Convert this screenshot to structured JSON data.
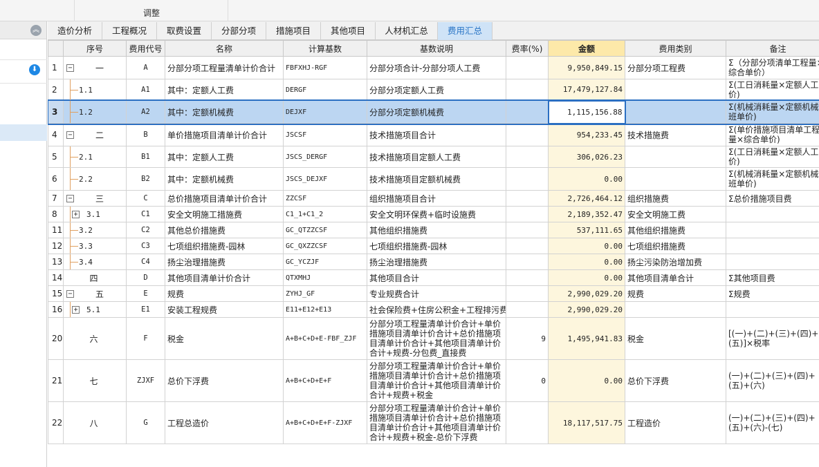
{
  "toolbar": {
    "adjust_label": "调整"
  },
  "tabs": [
    {
      "label": "造价分析",
      "w": 79
    },
    {
      "label": "工程概况",
      "w": 79
    },
    {
      "label": "取费设置",
      "w": 79
    },
    {
      "label": "分部分项",
      "w": 79
    },
    {
      "label": "措施项目",
      "w": 79
    },
    {
      "label": "其他项目",
      "w": 79
    },
    {
      "label": "人材机汇总",
      "w": 90
    },
    {
      "label": "费用汇总",
      "w": 79,
      "active": true
    }
  ],
  "table": {
    "headers": [
      "",
      "序号",
      "费用代号",
      "名称",
      "计算基数",
      "基数说明",
      "费率(%)",
      "金额",
      "费用类别",
      "备注"
    ],
    "rows": [
      {
        "rn": "1",
        "seq": "一",
        "lvl": 0,
        "tog": "−",
        "code": "A",
        "name": "分部分项工程量清单计价合计",
        "base": "FBFXHJ-RGF",
        "desc": "分部分项合计-分部分项人工费",
        "rate": "",
        "amt": "9,950,849.15",
        "cat": "分部分项工程费",
        "note": "Σ（分部分项清单工程量×综合单价）",
        "h": 33
      },
      {
        "rn": "2",
        "seq": "1.1",
        "lvl": 1,
        "code": "A1",
        "name": "其中：定额人工费",
        "base": "DERGF",
        "desc": "分部分项定额人工费",
        "rate": "",
        "amt": "17,479,127.84",
        "cat": "",
        "note": "Σ(工日消耗量×定额人工单价)",
        "h": 23
      },
      {
        "rn": "3",
        "seq": "1.2",
        "lvl": 1,
        "code": "A2",
        "name": "其中：定额机械费",
        "base": "DEJXF",
        "desc": "分部分项定额机械费",
        "rate": "",
        "amt": "1,115,156.88",
        "cat": "",
        "note": "Σ(机械消耗量×定额机械台班单价)",
        "h": 33,
        "sel": true
      },
      {
        "rn": "4",
        "seq": "二",
        "lvl": 0,
        "tog": "−",
        "code": "B",
        "name": "单价措施项目清单计价合计",
        "base": "JSCSF",
        "desc": "技术措施项目合计",
        "rate": "",
        "amt": "954,233.45",
        "cat": "技术措施费",
        "note": "Σ(单价措施项目清单工程量×综合单价)",
        "h": 33
      },
      {
        "rn": "5",
        "seq": "2.1",
        "lvl": 1,
        "code": "B1",
        "name": "其中：定额人工费",
        "base": "JSCS_DERGF",
        "desc": "技术措施项目定额人工费",
        "rate": "",
        "amt": "306,026.23",
        "cat": "",
        "note": "Σ(工日消耗量×定额人工单价)",
        "h": 23
      },
      {
        "rn": "6",
        "seq": "2.2",
        "lvl": 1,
        "code": "B2",
        "name": "其中：定额机械费",
        "base": "JSCS_DEJXF",
        "desc": "技术措施项目定额机械费",
        "rate": "",
        "amt": "0.00",
        "cat": "",
        "note": "Σ(机械消耗量×定额机械台班单价)",
        "h": 33
      },
      {
        "rn": "7",
        "seq": "三",
        "lvl": 0,
        "tog": "−",
        "code": "C",
        "name": "总价措施项目清单计价合计",
        "base": "ZZCSF",
        "desc": "组织措施项目合计",
        "rate": "",
        "amt": "2,726,464.12",
        "cat": "组织措施费",
        "note": "Σ总价措施项目费",
        "h": 23
      },
      {
        "rn": "8",
        "seq": "3.1",
        "lvl": 1,
        "tog": "+",
        "code": "C1",
        "name": "安全文明施工措施费",
        "base": "C1_1+C1_2",
        "desc": "安全文明环保费+临时设施费",
        "rate": "",
        "amt": "2,189,352.47",
        "cat": "安全文明施工费",
        "note": "",
        "h": 23
      },
      {
        "rn": "11",
        "seq": "3.2",
        "lvl": 1,
        "code": "C2",
        "name": "其他总价措施费",
        "base": "GC_QTZZCSF",
        "desc": "其他组织措施费",
        "rate": "",
        "amt": "537,111.65",
        "cat": "其他组织措施费",
        "note": "",
        "h": 23
      },
      {
        "rn": "12",
        "seq": "3.3",
        "lvl": 1,
        "code": "C3",
        "name": "七项组织措施费-园林",
        "base": "GC_QXZZCSF",
        "desc": "七项组织措施费-园林",
        "rate": "",
        "amt": "0.00",
        "cat": "七项组织措施费",
        "note": "",
        "h": 23
      },
      {
        "rn": "13",
        "seq": "3.4",
        "lvl": 1,
        "code": "C4",
        "name": "扬尘治理措施费",
        "base": "GC_YCZJF",
        "desc": "扬尘治理措施费",
        "rate": "",
        "amt": "0.00",
        "cat": "扬尘污染防治增加费",
        "note": "",
        "h": 23
      },
      {
        "rn": "14",
        "seq": "四",
        "lvl": 0,
        "code": "D",
        "name": "其他项目清单计价合计",
        "base": "QTXMHJ",
        "desc": "其他项目合计",
        "rate": "",
        "amt": "0.00",
        "cat": "其他项目清单合计",
        "note": "Σ其他项目费",
        "h": 23
      },
      {
        "rn": "15",
        "seq": "五",
        "lvl": 0,
        "tog": "−",
        "code": "E",
        "name": "规费",
        "base": "ZYHJ_GF",
        "desc": "专业规费合计",
        "rate": "",
        "amt": "2,990,029.20",
        "cat": "规费",
        "note": "Σ规费",
        "h": 23
      },
      {
        "rn": "16",
        "seq": "5.1",
        "lvl": 1,
        "tog": "+",
        "code": "E1",
        "name": "安装工程规费",
        "base": "E11+E12+E13",
        "desc": "社会保险费+住房公积金+工程排污费",
        "rate": "",
        "amt": "2,990,029.20",
        "cat": "",
        "note": "",
        "h": 23
      },
      {
        "rn": "20",
        "seq": "六",
        "lvl": 0,
        "code": "F",
        "name": "税金",
        "base": "A+B+C+D+E-FBF_ZJF",
        "desc": "分部分项工程量清单计价合计+单价措施项目清单计价合计+总价措施项目清单计价合计+其他项目清单计价合计+规费-分包费_直接费",
        "rate": "9",
        "amt": "1,495,941.83",
        "cat": "税金",
        "note": "[(一)+(二)+(三)+(四)+(五)]×税率",
        "h": 61
      },
      {
        "rn": "21",
        "seq": "七",
        "lvl": 0,
        "code": "ZJXF",
        "name": "总价下浮费",
        "base": "A+B+C+D+E+F",
        "desc": "分部分项工程量清单计价合计+单价措施项目清单计价合计+总价措施项目清单计价合计+其他项目清单计价合计+规费+税金",
        "rate": "0",
        "amt": "0.00",
        "cat": "总价下浮费",
        "note": "(一)+(二)+(三)+(四)+(五)+(六)",
        "h": 61
      },
      {
        "rn": "22",
        "seq": "八",
        "lvl": 0,
        "code": "G",
        "name": "工程总造价",
        "base": "A+B+C+D+E+F-ZJXF",
        "desc": "分部分项工程量清单计价合计+单价措施项目清单计价合计+总价措施项目清单计价合计+其他项目清单计价合计+规费+税金-总价下浮费",
        "rate": "",
        "amt": "18,117,517.75",
        "cat": "工程造价",
        "note": "(一)+(二)+(三)+(四)+(五)+(六)-(七)",
        "h": 61
      }
    ]
  },
  "colors": {
    "accent": "#2b6fc2",
    "tab_active_bg": "#cfe3f7",
    "amount_header_bg": "#fde9a9"
  },
  "icons": {
    "collapse": "double-chevron-up-icon",
    "download": "download-circle-icon"
  }
}
